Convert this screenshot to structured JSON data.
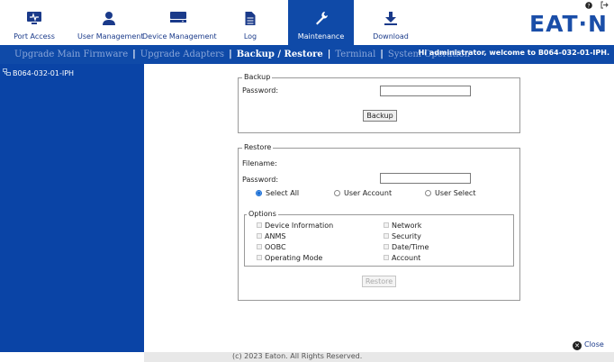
{
  "nav": {
    "items": [
      {
        "label": "Port Access",
        "icon": "monitor-icon"
      },
      {
        "label": "User Management",
        "icon": "user-icon"
      },
      {
        "label": "Device Management",
        "icon": "device-icon"
      },
      {
        "label": "Log",
        "icon": "log-document-icon"
      },
      {
        "label": "Maintenance",
        "icon": "wrench-icon"
      },
      {
        "label": "Download",
        "icon": "download-icon"
      }
    ],
    "active": "Maintenance",
    "logo_text": "EAT·N",
    "accent_color": "#0f4aa8"
  },
  "subnav": {
    "tabs": [
      "Upgrade Main Firmware",
      "Upgrade Adapters",
      "Backup / Restore",
      "Terminal",
      "System Operation"
    ],
    "active_tab": "Backup / Restore",
    "welcome": "Hi administrator, welcome to B064-032-01-IPH."
  },
  "sidebar": {
    "device": "B064-032-01-IPH"
  },
  "backup": {
    "legend": "Backup",
    "password_label": "Password:",
    "password_value": "",
    "button": "Backup"
  },
  "restore": {
    "legend": "Restore",
    "filename_label": "Filename:",
    "password_label": "Password:",
    "password_value": "",
    "radios": [
      {
        "label": "Select All",
        "checked": true
      },
      {
        "label": "User Account",
        "checked": false
      },
      {
        "label": "User Select",
        "checked": false
      }
    ],
    "options_legend": "Options",
    "options_left": [
      "Device Information",
      "ANMS",
      "OOBC",
      "Operating Mode"
    ],
    "options_right": [
      "Network",
      "Security",
      "Date/Time",
      "Account"
    ],
    "button": "Restore"
  },
  "close_label": "Close",
  "footer": "(c) 2023 Eaton. All Rights Reserved."
}
